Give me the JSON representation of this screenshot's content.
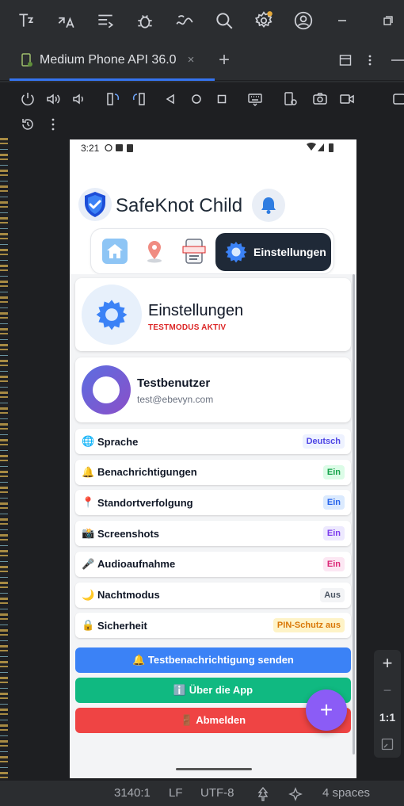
{
  "ide": {
    "toolbar_icons": [
      "project-icon",
      "translate-icon",
      "structure-icon",
      "debug-icon",
      "profile-icon",
      "search-icon",
      "settings-icon",
      "account-icon"
    ],
    "tab": {
      "label": "Medium Phone API 36.0",
      "close": "×",
      "add": "+"
    }
  },
  "phone": {
    "status_time": "3:21",
    "app_title": "SafeKnot Child",
    "nav_active_label": "Einstellungen",
    "settings": {
      "title": "Einstellungen",
      "subtitle": "TESTMODUS AKTIV"
    },
    "user": {
      "name": "Testbenutzer",
      "email": "test@ebevyn.com"
    },
    "rows": [
      {
        "emoji": "🌐",
        "label": "Sprache",
        "badge": "Deutsch",
        "badge_bg": "#eef2ff",
        "badge_fg": "#4f46e5"
      },
      {
        "emoji": "🔔",
        "label": "Benachrichtigungen",
        "badge": "Ein",
        "badge_bg": "#dcfce7",
        "badge_fg": "#16a34a"
      },
      {
        "emoji": "📍",
        "label": "Standortverfolgung",
        "badge": "Ein",
        "badge_bg": "#dbeafe",
        "badge_fg": "#2563eb"
      },
      {
        "emoji": "📸",
        "label": "Screenshots",
        "badge": "Ein",
        "badge_bg": "#ede9fe",
        "badge_fg": "#7c3aed"
      },
      {
        "emoji": "🎤",
        "label": "Audioaufnahme",
        "badge": "Ein",
        "badge_bg": "#fce7f3",
        "badge_fg": "#db2777"
      },
      {
        "emoji": "🌙",
        "label": "Nachtmodus",
        "badge": "Aus",
        "badge_bg": "#f3f4f6",
        "badge_fg": "#4b5563"
      },
      {
        "emoji": "🔒",
        "label": "Sicherheit",
        "badge": "PIN-Schutz aus",
        "badge_bg": "#fef3c7",
        "badge_fg": "#d97706"
      }
    ],
    "actions": [
      {
        "label": "🔔 Testbenachrichtigung senden",
        "color": "#3b82f6"
      },
      {
        "label": "ℹ️ Über die App",
        "color": "#10b981"
      },
      {
        "label": "🚪 Abmelden",
        "color": "#ef4444"
      }
    ],
    "fab": "+"
  },
  "zoom": {
    "in": "+",
    "out": "−",
    "ratio": "1:1"
  },
  "status_bar": {
    "position": "3140:1",
    "line_ending": "LF",
    "encoding": "UTF-8",
    "indent": "4 spaces"
  }
}
